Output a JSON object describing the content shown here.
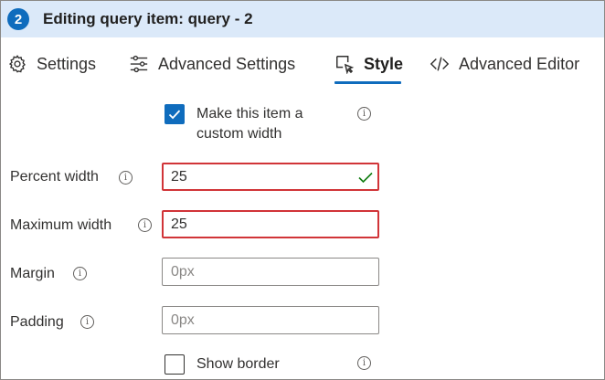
{
  "header": {
    "step_number": "2",
    "title": "Editing query item: query - 2",
    "accent_color": "#0f6cbd",
    "background_color": "#dbe9f9"
  },
  "tabs": [
    {
      "label": "Settings",
      "icon": "gear-icon",
      "active": false
    },
    {
      "label": "Advanced Settings",
      "icon": "sliders-icon",
      "active": false
    },
    {
      "label": "Style",
      "icon": "select-area-icon",
      "active": true
    },
    {
      "label": "Advanced Editor",
      "icon": "code-icon",
      "active": false
    }
  ],
  "form": {
    "custom_width": {
      "label": "Make this item a custom width",
      "checked": true
    },
    "percent_width": {
      "label": "Percent width",
      "value": "25",
      "state": "valid-but-highlighted"
    },
    "maximum_width": {
      "label": "Maximum width",
      "value": "25",
      "state": "highlighted"
    },
    "margin": {
      "label": "Margin",
      "value": "",
      "placeholder": "0px"
    },
    "padding": {
      "label": "Padding",
      "value": "",
      "placeholder": "0px"
    },
    "show_border": {
      "label": "Show border",
      "checked": false
    }
  },
  "colors": {
    "highlight_border": "#d13438",
    "valid_check": "#107c10"
  }
}
